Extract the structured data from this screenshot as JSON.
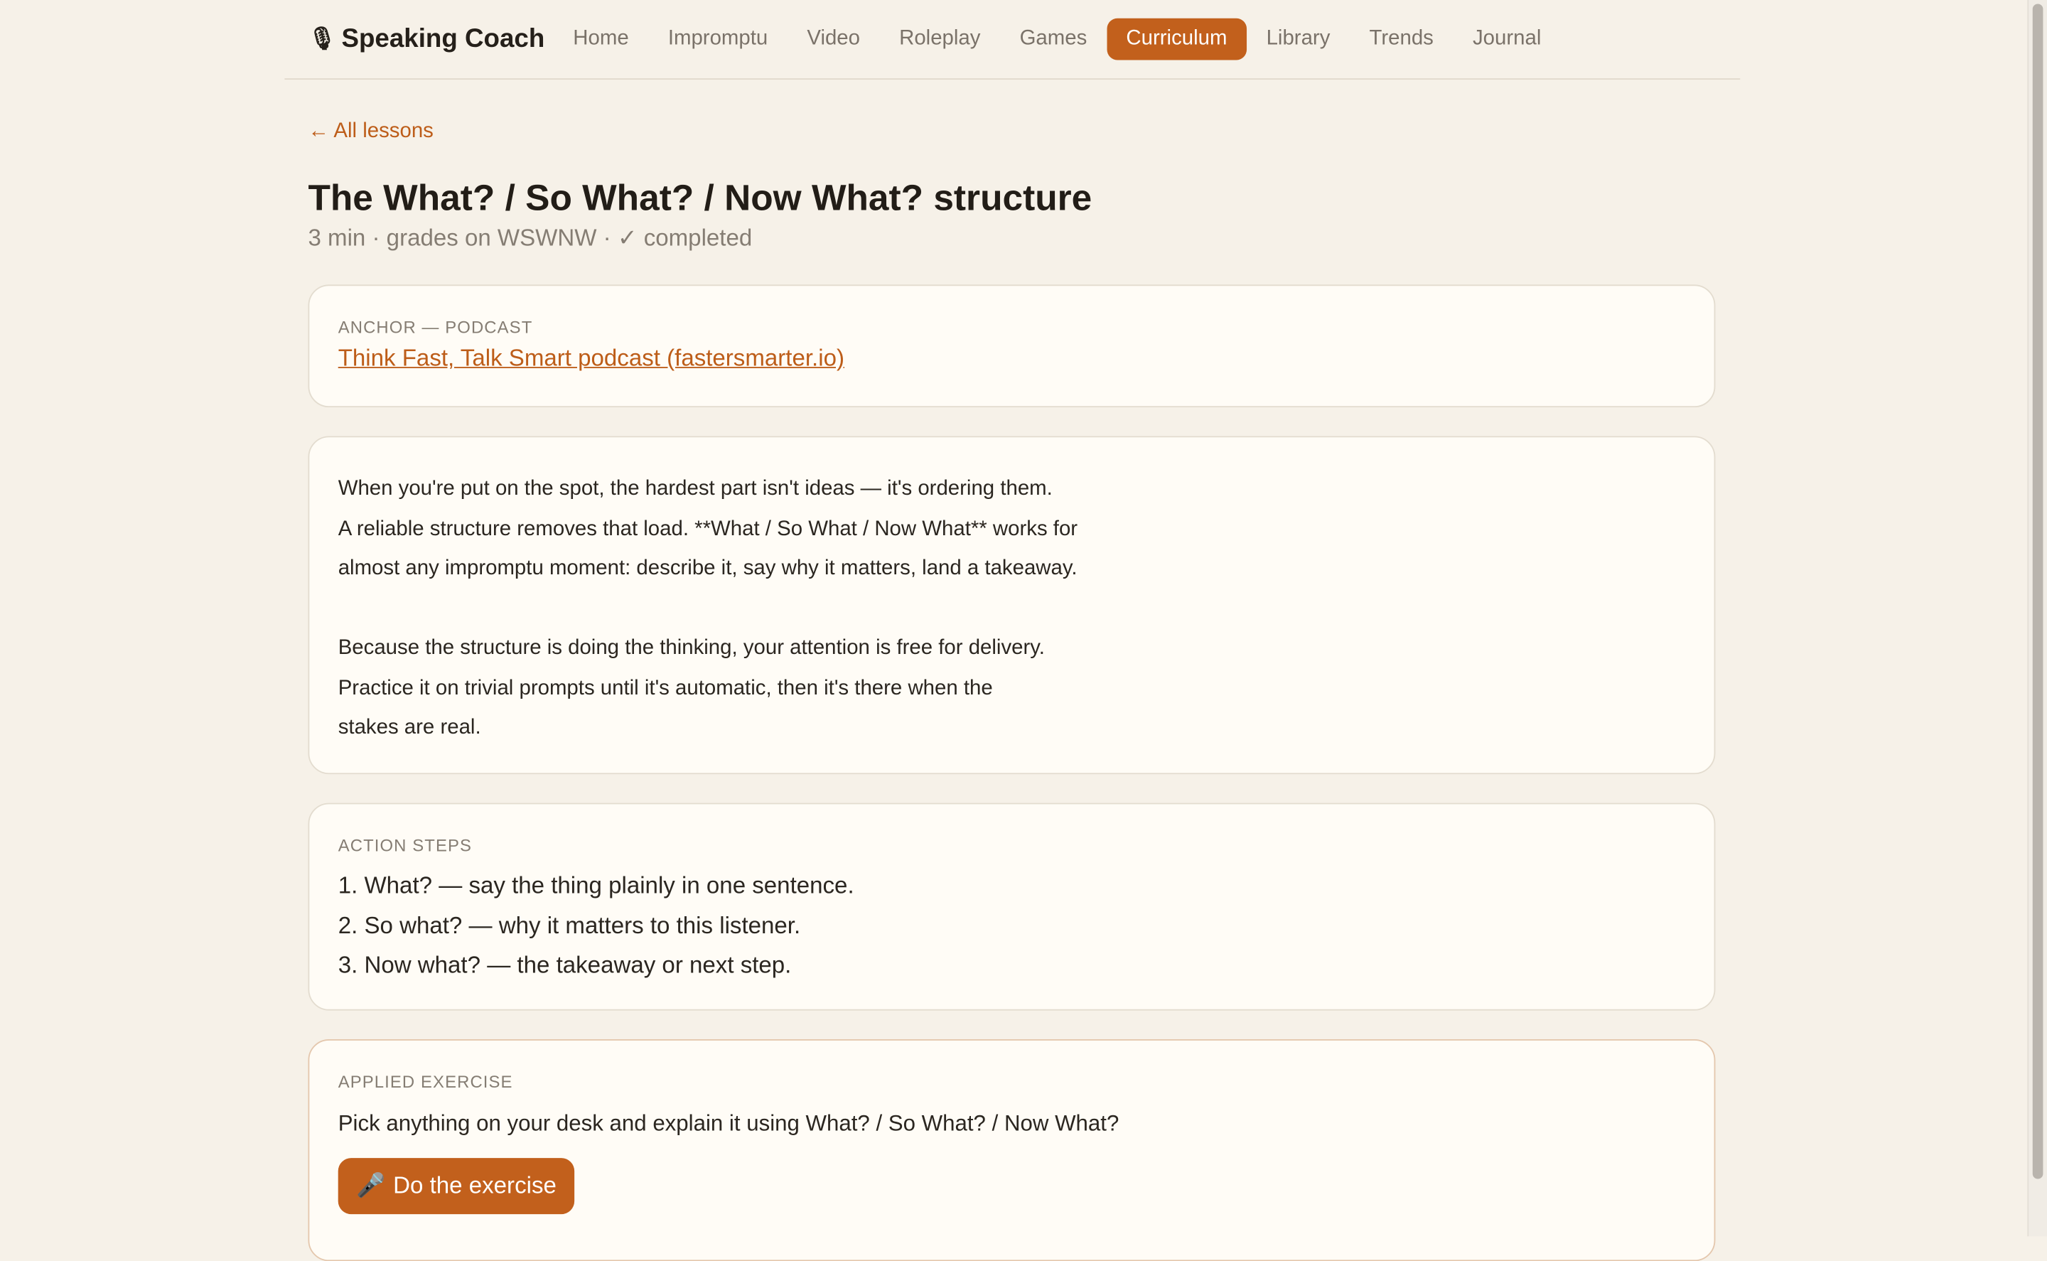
{
  "app": {
    "brand_icon": "🎙",
    "brand_name": "Speaking Coach"
  },
  "nav": {
    "items": [
      {
        "label": "Home"
      },
      {
        "label": "Impromptu"
      },
      {
        "label": "Video"
      },
      {
        "label": "Roleplay"
      },
      {
        "label": "Games"
      },
      {
        "label": "Curriculum",
        "active": true
      },
      {
        "label": "Library"
      },
      {
        "label": "Trends"
      },
      {
        "label": "Journal"
      }
    ]
  },
  "lesson": {
    "back_label": "← All lessons",
    "title": "The What? / So What? / Now What? structure",
    "meta": "3 min · grades on WSWNW · ✓ completed",
    "anchor": {
      "label": "ANCHOR — PODCAST",
      "link_text": "Think Fast, Talk Smart podcast (fastersmarter.io)"
    },
    "body": {
      "para1": [
        "When you're put on the spot, the hardest part isn't ideas — it's ordering them.",
        "A reliable structure removes that load. **What / So What / Now What** works for",
        "almost any impromptu moment: describe it, say why it matters, land a takeaway."
      ],
      "para2": [
        "Because the structure is doing the thinking, your attention is free for delivery.",
        "Practice it on trivial prompts until it's automatic, then it's there when the",
        "stakes are real."
      ]
    },
    "action_steps": {
      "label": "ACTION STEPS",
      "items": [
        "1. What? — say the thing plainly in one sentence.",
        "2. So what? — why it matters to this listener.",
        "3. Now what? — the takeaway or next step."
      ]
    },
    "exercise": {
      "label": "APPLIED EXERCISE",
      "text": "Pick anything on your desk and explain it using What? / So What? / Now What?",
      "button_icon": "🎤",
      "button_label": "Do the exercise"
    }
  },
  "colors": {
    "accent": "#c2601c",
    "background": "#f6f1e8",
    "card": "#fffcf6"
  }
}
